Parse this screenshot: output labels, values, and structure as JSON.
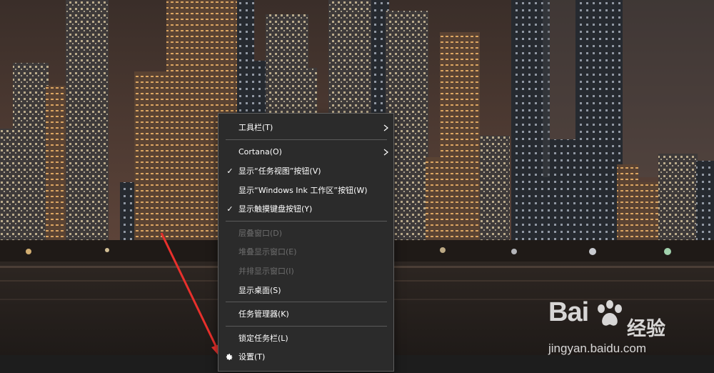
{
  "menu": {
    "items": [
      {
        "label": "工具栏(T)",
        "submenu": true,
        "checked": false,
        "disabled": false
      },
      {
        "label": "Cortana(O)",
        "submenu": true,
        "checked": false,
        "disabled": false
      },
      {
        "label": "显示“任务视图”按钮(V)",
        "submenu": false,
        "checked": true,
        "disabled": false
      },
      {
        "label": "显示“Windows Ink 工作区”按钮(W)",
        "submenu": false,
        "checked": false,
        "disabled": false
      },
      {
        "label": "显示触摸键盘按钮(Y)",
        "submenu": false,
        "checked": true,
        "disabled": false
      },
      {
        "label": "层叠窗口(D)",
        "submenu": false,
        "checked": false,
        "disabled": true
      },
      {
        "label": "堆叠显示窗口(E)",
        "submenu": false,
        "checked": false,
        "disabled": true
      },
      {
        "label": "并排显示窗口(I)",
        "submenu": false,
        "checked": false,
        "disabled": true
      },
      {
        "label": "显示桌面(S)",
        "submenu": false,
        "checked": false,
        "disabled": false
      },
      {
        "label": "任务管理器(K)",
        "submenu": false,
        "checked": false,
        "disabled": false
      },
      {
        "label": "锁定任务栏(L)",
        "submenu": false,
        "checked": false,
        "disabled": false
      },
      {
        "label": "设置(T)",
        "submenu": false,
        "checked": false,
        "disabled": false,
        "icon": "gear-icon"
      }
    ],
    "check_mark": "✓"
  },
  "watermark": {
    "logo_text": "Bai",
    "logo_cn": "经验",
    "url": "jingyan.baidu.com",
    "icon": "paw-icon"
  },
  "annotation": {
    "arrow_color": "#e8302c",
    "icon": "red-arrow"
  },
  "colors": {
    "menu_bg": "#2b2b2b",
    "menu_text": "#ffffff",
    "disabled_text": "#6d6d6d",
    "separator": "#5a5a5a"
  }
}
